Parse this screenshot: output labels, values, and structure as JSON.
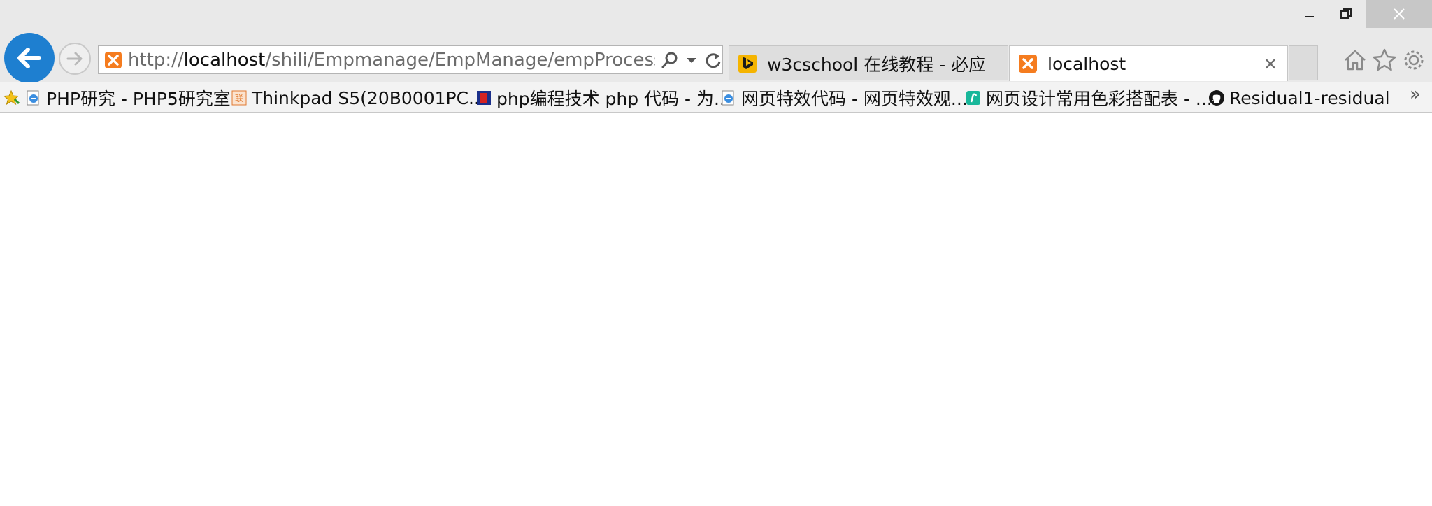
{
  "window": {
    "minimize_icon": "minimize-icon",
    "restore_icon": "restore-icon",
    "close_icon": "close-icon"
  },
  "nav": {
    "back_icon": "back-arrow-icon",
    "forward_icon": "forward-arrow-icon"
  },
  "address_bar": {
    "url_prefix": "http://",
    "url_host": "localhost",
    "url_rest": "/shili/Empmanage/EmpManage/empProcess.php?r",
    "favicon": "xampp-icon",
    "search_icon": "search-icon",
    "dropdown_icon": "chevron-down-icon",
    "refresh_icon": "refresh-icon"
  },
  "tabs": [
    {
      "title": "w3cschool 在线教程 - 必应",
      "icon": "bing-icon",
      "active": false
    },
    {
      "title": "localhost",
      "icon": "xampp-icon",
      "active": true
    }
  ],
  "tab_close_label": "✕",
  "toolbar": {
    "home_icon": "home-icon",
    "favorites_icon": "star-icon",
    "settings_icon": "gear-icon"
  },
  "favorites_bar": {
    "items": [
      {
        "label": "PHP研究 - PHP5研究室",
        "icon": "ie-page-icon"
      },
      {
        "label": "Thinkpad S5(20B0001PC...",
        "icon": "site-icon"
      },
      {
        "label": "php编程技术 php 代码 - 为...",
        "icon": "php-site-icon"
      },
      {
        "label": "网页特效代码 - 网页特效观...",
        "icon": "ie-page-icon"
      },
      {
        "label": "网页设计常用色彩搭配表 - ...",
        "icon": "green-site-icon"
      },
      {
        "label": "Residual1-residual",
        "icon": "github-icon"
      }
    ],
    "more_label": "»"
  },
  "colors": {
    "chrome_bg": "#e9e9e9",
    "back_button": "#1e7fd0",
    "close_button_bg": "#c7c7c7"
  }
}
